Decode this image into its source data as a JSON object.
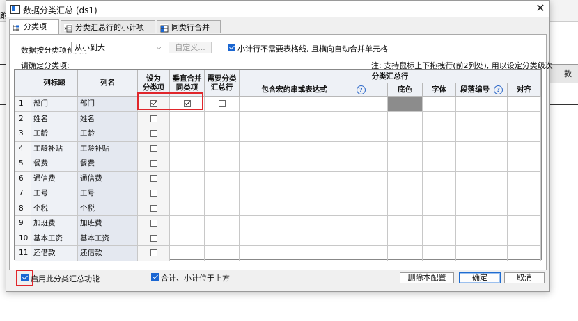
{
  "background": {
    "cut_text": "跗",
    "right_cell_text": "款"
  },
  "dialog": {
    "title": "数据分类汇总 (ds1)",
    "tabs": [
      {
        "label": "分类项",
        "icon": "tree-icon"
      },
      {
        "label": "分类汇总行的小计项",
        "icon": "sum-icon"
      },
      {
        "label": "同类行合并",
        "icon": "merge-icon"
      }
    ],
    "sort_label": "数据按分类项预排序:",
    "sort_value": "从小到大",
    "custom_button": "自定义...",
    "no_border_label": "小计行不需要表格线, 且横向自动合并单元格",
    "select_label": "请确定分类项:",
    "note": "注: 支持鼠标上下拖拽行(前2列处), 用以设定分类级次",
    "grid": {
      "headers": {
        "col_title": "列标题",
        "col_name": "列名",
        "set_as_category": "设为\n分类项",
        "vertical_merge": "垂直合并\n同类项",
        "need_subtotal": "需要分类\n汇总行",
        "group": "分类汇总行",
        "macro": "包含宏的串或表达式",
        "bg_color": "底色",
        "font": "字体",
        "paragraph": "段落编号",
        "align": "对齐"
      },
      "rows": [
        {
          "n": "1",
          "title": "部门",
          "name": "部门",
          "category": true,
          "merge": true,
          "subtotal": false
        },
        {
          "n": "2",
          "title": "姓名",
          "name": "姓名",
          "category": false
        },
        {
          "n": "3",
          "title": "工龄",
          "name": "工龄",
          "category": false
        },
        {
          "n": "4",
          "title": "工龄补贴",
          "name": "工龄补贴",
          "category": false
        },
        {
          "n": "5",
          "title": "餐费",
          "name": "餐费",
          "category": false
        },
        {
          "n": "6",
          "title": "通信费",
          "name": "通信费",
          "category": false
        },
        {
          "n": "7",
          "title": "工号",
          "name": "工号",
          "category": false
        },
        {
          "n": "8",
          "title": "个税",
          "name": "个税",
          "category": false
        },
        {
          "n": "9",
          "title": "加班费",
          "name": "加班费",
          "category": false
        },
        {
          "n": "10",
          "title": "基本工资",
          "name": "基本工资",
          "category": false
        },
        {
          "n": "11",
          "title": "还借款",
          "name": "还借款",
          "category": false
        }
      ]
    },
    "enable_label": "启用此分类汇总功能",
    "top_label": "合计、小计位于上方",
    "delete_button": "删除本配置",
    "ok_button": "确定",
    "cancel_button": "取消",
    "colors": {
      "accent": "#1a66d2",
      "highlight": "#e0262b",
      "bg_swatch": "#8c8c8c"
    }
  }
}
